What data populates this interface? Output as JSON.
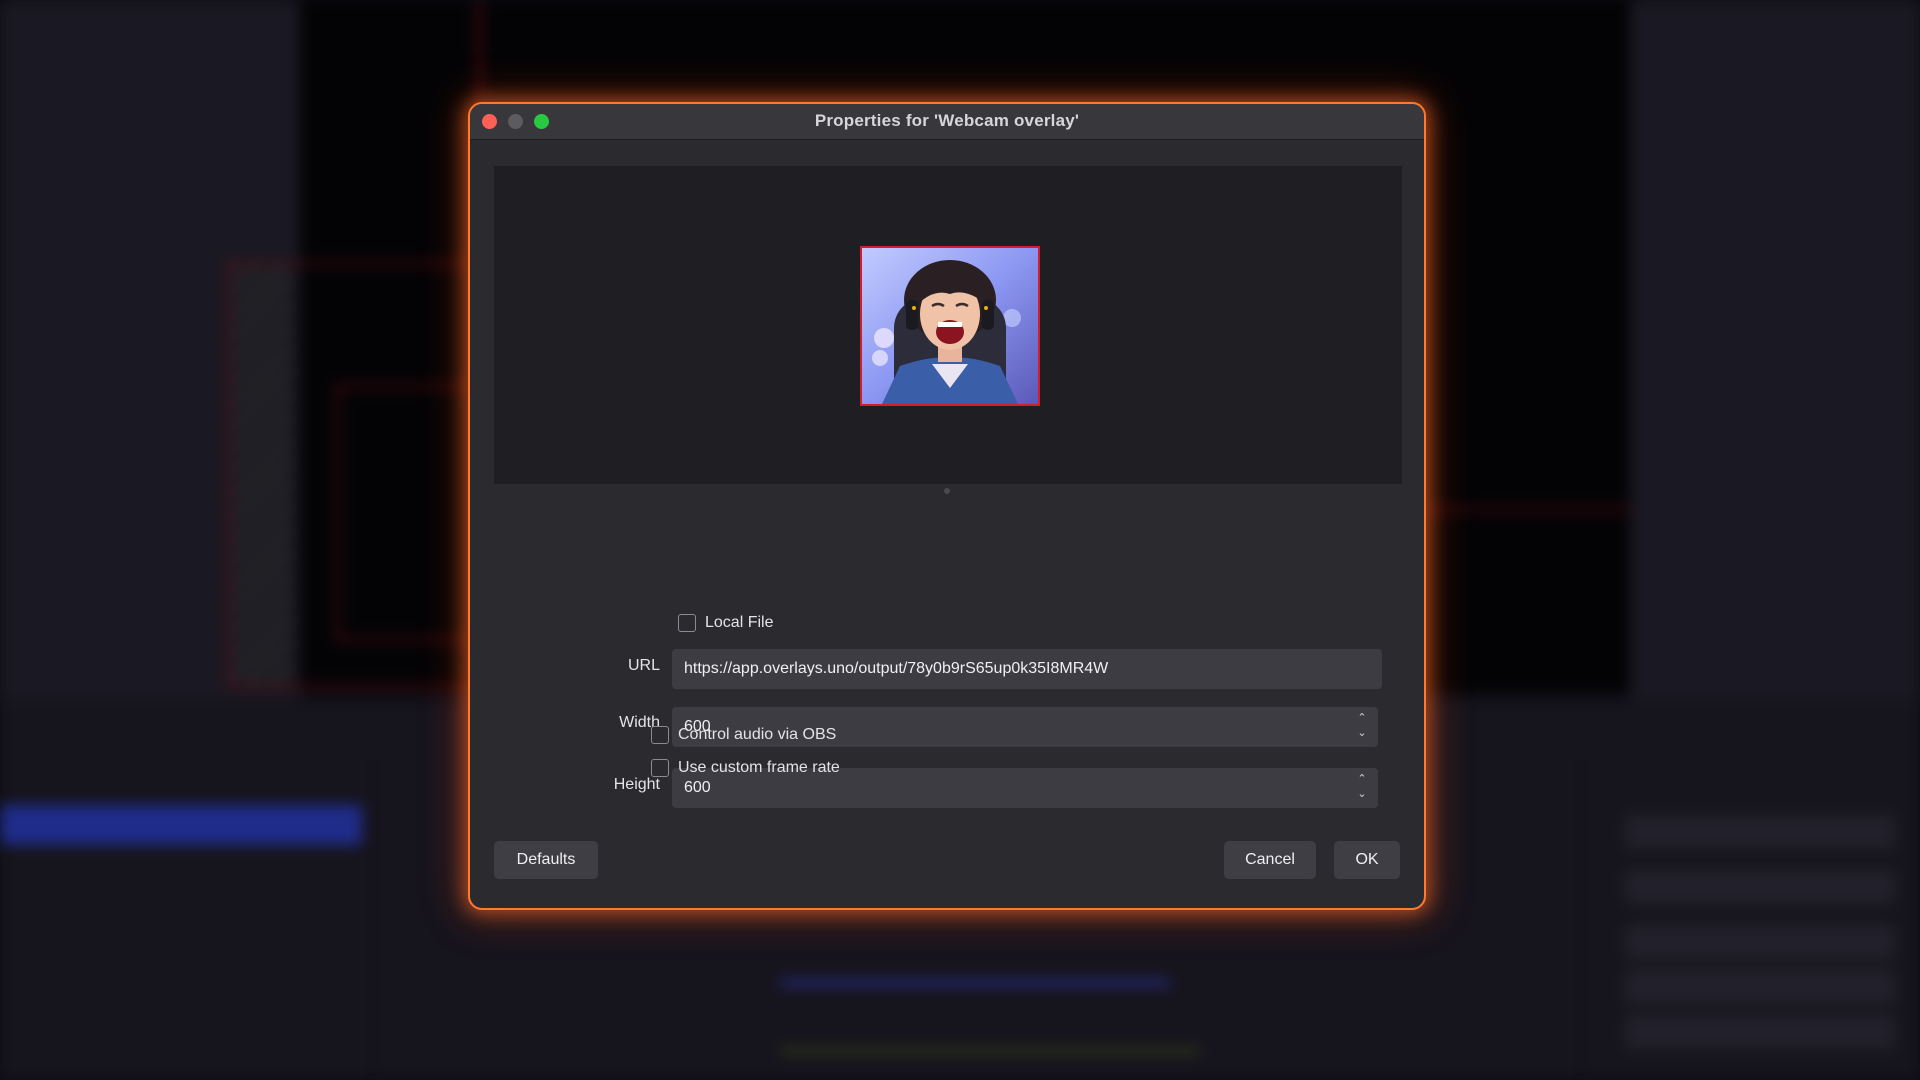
{
  "window": {
    "title": "Properties for 'Webcam overlay'"
  },
  "preview": {
    "image": "webcam-person-shouting"
  },
  "form": {
    "local_file_label": "Local File",
    "local_file_checked": false,
    "url_label": "URL",
    "url_value": "https://app.overlays.uno/output/78y0b9rS65up0k35I8MR4W",
    "width_label": "Width",
    "width_value": "600",
    "height_label": "Height",
    "height_value": "600",
    "control_audio_label": "Control audio via OBS",
    "control_audio_checked": false,
    "custom_frame_rate_label": "Use custom frame rate",
    "custom_frame_rate_checked": false
  },
  "buttons": {
    "defaults": "Defaults",
    "cancel": "Cancel",
    "ok": "OK"
  },
  "colors": {
    "dialog_border": "#ff7a2e",
    "close": "#fe5f57",
    "minimize": "#5b5b60",
    "maximize": "#28c840",
    "thumb_border": "#d31d2e"
  }
}
